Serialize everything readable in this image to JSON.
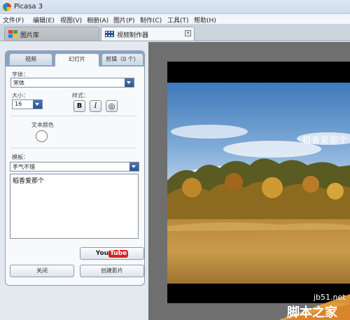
{
  "window": {
    "title": "Picasa 3"
  },
  "menu": [
    "文件(F)",
    "编辑(E)",
    "视图(V)",
    "相册(A)",
    "图片(P)",
    "制作(C)",
    "工具(T)",
    "帮助(H)"
  ],
  "tabs": {
    "library": "图片库",
    "video_maker": "视频制作器",
    "close_glyph": "×"
  },
  "panel": {
    "tabs": [
      "视频",
      "幻灯片",
      "剪辑（0 个）"
    ],
    "font_label": "字体：",
    "font_value": "宋体",
    "size_label": "大小：",
    "size_value": "16",
    "style_label": "样式：",
    "bold": "B",
    "italic": "I",
    "outline": "◎",
    "text_color_label": "文本颜色",
    "template_label": "模板：",
    "template_value": "手气不错",
    "text_value": "稻香爱那个"
  },
  "buttons": {
    "youtube_you": "You",
    "youtube_tube": "Tube",
    "close": "关闭",
    "create_movie": "创建影片"
  },
  "preview": {
    "overlay_text": "稻香爱那个"
  },
  "watermark": {
    "site": "jb51.net",
    "name": "脚本之家"
  }
}
